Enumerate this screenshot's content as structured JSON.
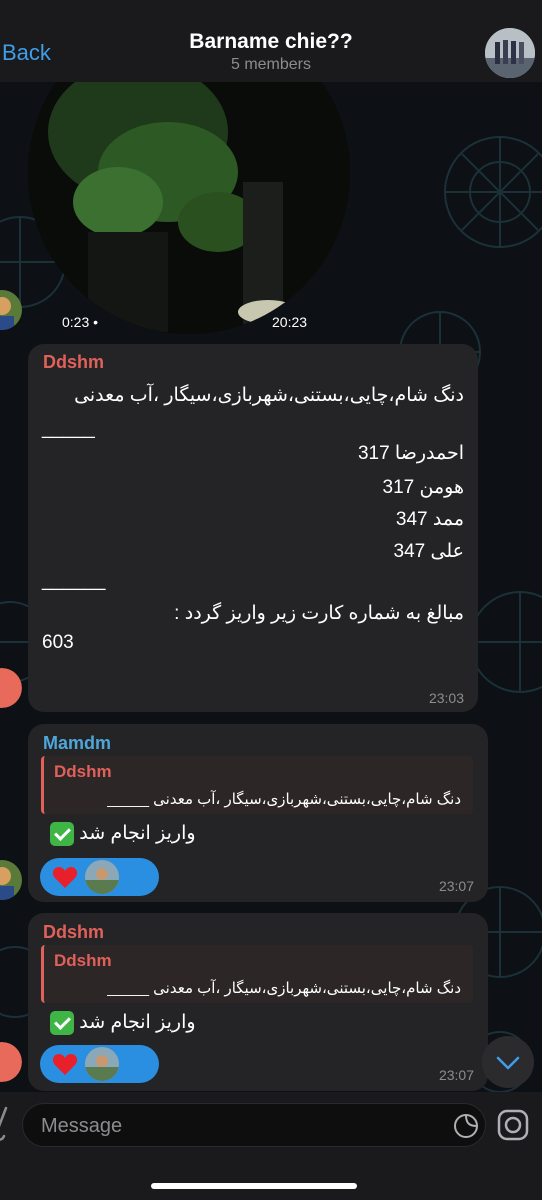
{
  "header": {
    "back_label": "Back",
    "title": "Barname chie??",
    "subtitle": "5 members"
  },
  "video_message": {
    "duration": "0:23",
    "time": "20:23"
  },
  "messages": [
    {
      "sender": "Ddshm",
      "sender_color": "#e0605a",
      "lines": [
        "دنگ شام،چایی،بستنی،شهربازی،سیگار ،آب معدنی",
        "_____",
        "احمدرضا 317",
        "هومن 317",
        "ممد 347",
        "علی 347",
        "______",
        "مبالغ به شماره کارت زیر واریز گردد :",
        "603"
      ],
      "time": "23:03"
    },
    {
      "sender": "Mamdm",
      "sender_color": "#4fa6d8",
      "reply": {
        "name": "Ddshm",
        "text": "دنگ شام،چایی،بستنی،شهربازی،سیگار ،آب معدنی _____"
      },
      "text": "واریز انجام شد",
      "time": "23:07"
    },
    {
      "sender": "Ddshm",
      "sender_color": "#e0605a",
      "reply": {
        "name": "Ddshm",
        "text": "دنگ شام،چایی،بستنی،شهربازی،سیگار ،آب معدنی _____"
      },
      "text": "واریز انجام شد",
      "time": "23:07"
    }
  ],
  "input": {
    "placeholder": "Message"
  },
  "colors": {
    "accent": "#3e9ee8",
    "bubble": "#242426",
    "reaction": "#2a8fe0"
  }
}
